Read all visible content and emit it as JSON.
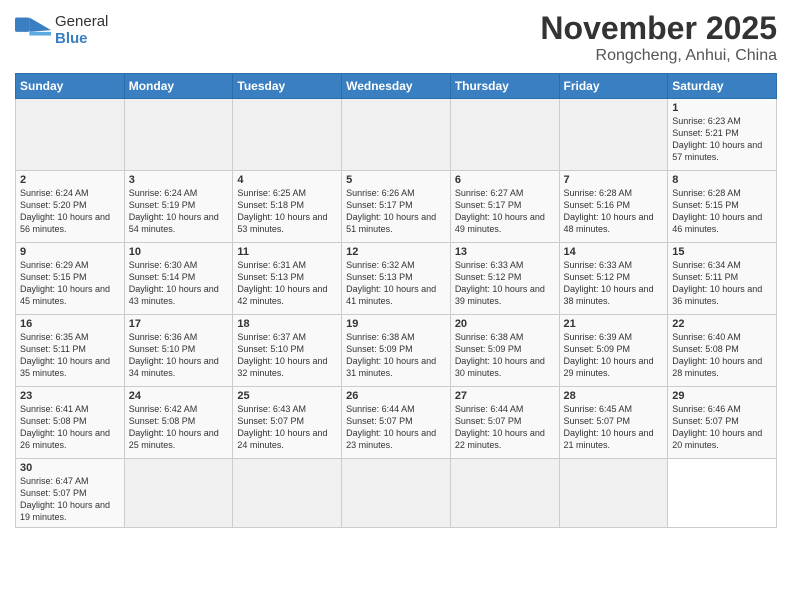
{
  "header": {
    "logo_general": "General",
    "logo_blue": "Blue",
    "month_title": "November 2025",
    "subtitle": "Rongcheng, Anhui, China"
  },
  "weekdays": [
    "Sunday",
    "Monday",
    "Tuesday",
    "Wednesday",
    "Thursday",
    "Friday",
    "Saturday"
  ],
  "days": [
    {
      "num": "",
      "sunrise": "",
      "sunset": "",
      "daylight": ""
    },
    {
      "num": "",
      "sunrise": "",
      "sunset": "",
      "daylight": ""
    },
    {
      "num": "",
      "sunrise": "",
      "sunset": "",
      "daylight": ""
    },
    {
      "num": "",
      "sunrise": "",
      "sunset": "",
      "daylight": ""
    },
    {
      "num": "",
      "sunrise": "",
      "sunset": "",
      "daylight": ""
    },
    {
      "num": "",
      "sunrise": "",
      "sunset": "",
      "daylight": ""
    },
    {
      "num": "1",
      "sunrise": "Sunrise: 6:23 AM",
      "sunset": "Sunset: 5:21 PM",
      "daylight": "Daylight: 10 hours and 57 minutes."
    },
    {
      "num": "2",
      "sunrise": "Sunrise: 6:24 AM",
      "sunset": "Sunset: 5:20 PM",
      "daylight": "Daylight: 10 hours and 56 minutes."
    },
    {
      "num": "3",
      "sunrise": "Sunrise: 6:24 AM",
      "sunset": "Sunset: 5:19 PM",
      "daylight": "Daylight: 10 hours and 54 minutes."
    },
    {
      "num": "4",
      "sunrise": "Sunrise: 6:25 AM",
      "sunset": "Sunset: 5:18 PM",
      "daylight": "Daylight: 10 hours and 53 minutes."
    },
    {
      "num": "5",
      "sunrise": "Sunrise: 6:26 AM",
      "sunset": "Sunset: 5:17 PM",
      "daylight": "Daylight: 10 hours and 51 minutes."
    },
    {
      "num": "6",
      "sunrise": "Sunrise: 6:27 AM",
      "sunset": "Sunset: 5:17 PM",
      "daylight": "Daylight: 10 hours and 49 minutes."
    },
    {
      "num": "7",
      "sunrise": "Sunrise: 6:28 AM",
      "sunset": "Sunset: 5:16 PM",
      "daylight": "Daylight: 10 hours and 48 minutes."
    },
    {
      "num": "8",
      "sunrise": "Sunrise: 6:28 AM",
      "sunset": "Sunset: 5:15 PM",
      "daylight": "Daylight: 10 hours and 46 minutes."
    },
    {
      "num": "9",
      "sunrise": "Sunrise: 6:29 AM",
      "sunset": "Sunset: 5:15 PM",
      "daylight": "Daylight: 10 hours and 45 minutes."
    },
    {
      "num": "10",
      "sunrise": "Sunrise: 6:30 AM",
      "sunset": "Sunset: 5:14 PM",
      "daylight": "Daylight: 10 hours and 43 minutes."
    },
    {
      "num": "11",
      "sunrise": "Sunrise: 6:31 AM",
      "sunset": "Sunset: 5:13 PM",
      "daylight": "Daylight: 10 hours and 42 minutes."
    },
    {
      "num": "12",
      "sunrise": "Sunrise: 6:32 AM",
      "sunset": "Sunset: 5:13 PM",
      "daylight": "Daylight: 10 hours and 41 minutes."
    },
    {
      "num": "13",
      "sunrise": "Sunrise: 6:33 AM",
      "sunset": "Sunset: 5:12 PM",
      "daylight": "Daylight: 10 hours and 39 minutes."
    },
    {
      "num": "14",
      "sunrise": "Sunrise: 6:33 AM",
      "sunset": "Sunset: 5:12 PM",
      "daylight": "Daylight: 10 hours and 38 minutes."
    },
    {
      "num": "15",
      "sunrise": "Sunrise: 6:34 AM",
      "sunset": "Sunset: 5:11 PM",
      "daylight": "Daylight: 10 hours and 36 minutes."
    },
    {
      "num": "16",
      "sunrise": "Sunrise: 6:35 AM",
      "sunset": "Sunset: 5:11 PM",
      "daylight": "Daylight: 10 hours and 35 minutes."
    },
    {
      "num": "17",
      "sunrise": "Sunrise: 6:36 AM",
      "sunset": "Sunset: 5:10 PM",
      "daylight": "Daylight: 10 hours and 34 minutes."
    },
    {
      "num": "18",
      "sunrise": "Sunrise: 6:37 AM",
      "sunset": "Sunset: 5:10 PM",
      "daylight": "Daylight: 10 hours and 32 minutes."
    },
    {
      "num": "19",
      "sunrise": "Sunrise: 6:38 AM",
      "sunset": "Sunset: 5:09 PM",
      "daylight": "Daylight: 10 hours and 31 minutes."
    },
    {
      "num": "20",
      "sunrise": "Sunrise: 6:38 AM",
      "sunset": "Sunset: 5:09 PM",
      "daylight": "Daylight: 10 hours and 30 minutes."
    },
    {
      "num": "21",
      "sunrise": "Sunrise: 6:39 AM",
      "sunset": "Sunset: 5:09 PM",
      "daylight": "Daylight: 10 hours and 29 minutes."
    },
    {
      "num": "22",
      "sunrise": "Sunrise: 6:40 AM",
      "sunset": "Sunset: 5:08 PM",
      "daylight": "Daylight: 10 hours and 28 minutes."
    },
    {
      "num": "23",
      "sunrise": "Sunrise: 6:41 AM",
      "sunset": "Sunset: 5:08 PM",
      "daylight": "Daylight: 10 hours and 26 minutes."
    },
    {
      "num": "24",
      "sunrise": "Sunrise: 6:42 AM",
      "sunset": "Sunset: 5:08 PM",
      "daylight": "Daylight: 10 hours and 25 minutes."
    },
    {
      "num": "25",
      "sunrise": "Sunrise: 6:43 AM",
      "sunset": "Sunset: 5:07 PM",
      "daylight": "Daylight: 10 hours and 24 minutes."
    },
    {
      "num": "26",
      "sunrise": "Sunrise: 6:44 AM",
      "sunset": "Sunset: 5:07 PM",
      "daylight": "Daylight: 10 hours and 23 minutes."
    },
    {
      "num": "27",
      "sunrise": "Sunrise: 6:44 AM",
      "sunset": "Sunset: 5:07 PM",
      "daylight": "Daylight: 10 hours and 22 minutes."
    },
    {
      "num": "28",
      "sunrise": "Sunrise: 6:45 AM",
      "sunset": "Sunset: 5:07 PM",
      "daylight": "Daylight: 10 hours and 21 minutes."
    },
    {
      "num": "29",
      "sunrise": "Sunrise: 6:46 AM",
      "sunset": "Sunset: 5:07 PM",
      "daylight": "Daylight: 10 hours and 20 minutes."
    },
    {
      "num": "30",
      "sunrise": "Sunrise: 6:47 AM",
      "sunset": "Sunset: 5:07 PM",
      "daylight": "Daylight: 10 hours and 19 minutes."
    },
    {
      "num": "",
      "sunrise": "",
      "sunset": "",
      "daylight": ""
    },
    {
      "num": "",
      "sunrise": "",
      "sunset": "",
      "daylight": ""
    },
    {
      "num": "",
      "sunrise": "",
      "sunset": "",
      "daylight": ""
    },
    {
      "num": "",
      "sunrise": "",
      "sunset": "",
      "daylight": ""
    },
    {
      "num": "",
      "sunrise": "",
      "sunset": "",
      "daylight": ""
    }
  ]
}
